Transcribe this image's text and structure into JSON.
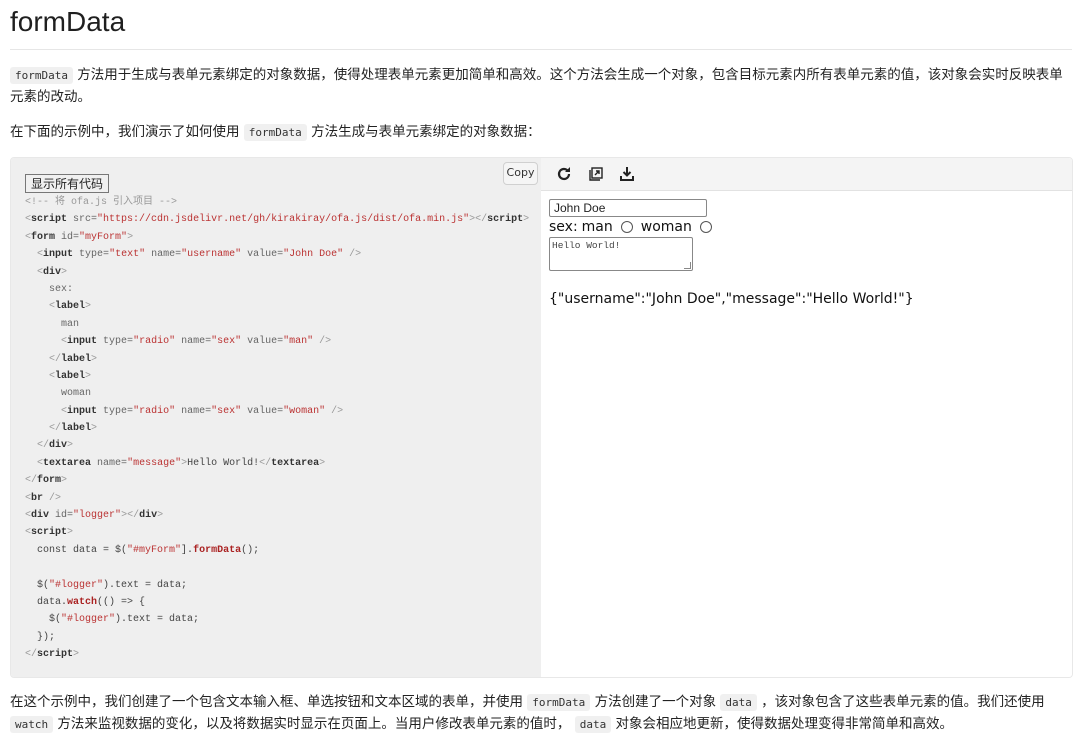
{
  "page": {
    "title": "formData",
    "intro": {
      "code": "formData",
      "text": "方法用于生成与表单元素绑定的对象数据，使得处理表单元素更加简单和高效。这个方法会生成一个对象，包含目标元素内所有表单元素的值，该对象会实时反映表单元素的改动。"
    },
    "example_intro": {
      "before": "在下面的示例中，我们演示了如何使用",
      "code": "formData",
      "after": "方法生成与表单元素绑定的对象数据："
    },
    "outro": {
      "p1": "在这个示例中，我们创建了一个包含文本输入框、单选按钮和文本区域的表单，并使用",
      "c1": "formData",
      "p2": "方法创建了一个对象",
      "c2": "data",
      "p3": "，该对象包含了这些表单元素的值。我们还使用",
      "c3": "watch",
      "p4": "方法来监视数据的变化，以及将数据实时显示在页面上。当用户修改表单元素的值时，",
      "c4": "data",
      "p5": "对象会相应地更新，使得数据处理变得非常简单和高效。"
    }
  },
  "demo": {
    "show_all_label": "显示所有代码",
    "copy_label": "Copy",
    "toolbar_icons": [
      "refresh-icon",
      "open-external-icon",
      "download-icon"
    ],
    "code_lines": [
      [
        [
          "c",
          "<!-- 将 ofa.js 引入项目 -->"
        ]
      ],
      [
        [
          "p",
          "<"
        ],
        [
          "t",
          "script"
        ],
        [
          "a",
          " src="
        ],
        [
          "s",
          "\"https://cdn.jsdelivr.net/gh/kirakiray/ofa.js/dist/ofa.min.js\""
        ],
        [
          "p",
          "></"
        ],
        [
          "t",
          "script"
        ],
        [
          "p",
          ">"
        ]
      ],
      [
        [
          "p",
          "<"
        ],
        [
          "t",
          "form"
        ],
        [
          "a",
          " id="
        ],
        [
          "s",
          "\"myForm\""
        ],
        [
          "p",
          ">"
        ]
      ],
      [
        [
          "x",
          "  "
        ],
        [
          "p",
          "<"
        ],
        [
          "t",
          "input"
        ],
        [
          "a",
          " type="
        ],
        [
          "s",
          "\"text\""
        ],
        [
          "a",
          " name="
        ],
        [
          "s",
          "\"username\""
        ],
        [
          "a",
          " value="
        ],
        [
          "s",
          "\"John Doe\""
        ],
        [
          "p",
          " />"
        ]
      ],
      [
        [
          "x",
          "  "
        ],
        [
          "p",
          "<"
        ],
        [
          "t",
          "div"
        ],
        [
          "p",
          ">"
        ]
      ],
      [
        [
          "x",
          "    sex:"
        ]
      ],
      [
        [
          "x",
          "    "
        ],
        [
          "p",
          "<"
        ],
        [
          "t",
          "label"
        ],
        [
          "p",
          ">"
        ]
      ],
      [
        [
          "x",
          "      man"
        ]
      ],
      [
        [
          "x",
          "      "
        ],
        [
          "p",
          "<"
        ],
        [
          "t",
          "input"
        ],
        [
          "a",
          " type="
        ],
        [
          "s",
          "\"radio\""
        ],
        [
          "a",
          " name="
        ],
        [
          "s",
          "\"sex\""
        ],
        [
          "a",
          " value="
        ],
        [
          "s",
          "\"man\""
        ],
        [
          "p",
          " />"
        ]
      ],
      [
        [
          "x",
          "    "
        ],
        [
          "p",
          "</"
        ],
        [
          "t",
          "label"
        ],
        [
          "p",
          ">"
        ]
      ],
      [
        [
          "x",
          "    "
        ],
        [
          "p",
          "<"
        ],
        [
          "t",
          "label"
        ],
        [
          "p",
          ">"
        ]
      ],
      [
        [
          "x",
          "      woman"
        ]
      ],
      [
        [
          "x",
          "      "
        ],
        [
          "p",
          "<"
        ],
        [
          "t",
          "input"
        ],
        [
          "a",
          " type="
        ],
        [
          "s",
          "\"radio\""
        ],
        [
          "a",
          " name="
        ],
        [
          "s",
          "\"sex\""
        ],
        [
          "a",
          " value="
        ],
        [
          "s",
          "\"woman\""
        ],
        [
          "p",
          " />"
        ]
      ],
      [
        [
          "x",
          "    "
        ],
        [
          "p",
          "</"
        ],
        [
          "t",
          "label"
        ],
        [
          "p",
          ">"
        ]
      ],
      [
        [
          "x",
          "  "
        ],
        [
          "p",
          "</"
        ],
        [
          "t",
          "div"
        ],
        [
          "p",
          ">"
        ]
      ],
      [
        [
          "x",
          "  "
        ],
        [
          "p",
          "<"
        ],
        [
          "t",
          "textarea"
        ],
        [
          "a",
          " name="
        ],
        [
          "s",
          "\"message\""
        ],
        [
          "p",
          ">"
        ],
        [
          "v",
          "Hello World!"
        ],
        [
          "p",
          "</"
        ],
        [
          "t",
          "textarea"
        ],
        [
          "p",
          ">"
        ]
      ],
      [
        [
          "p",
          "</"
        ],
        [
          "t",
          "form"
        ],
        [
          "p",
          ">"
        ]
      ],
      [
        [
          "p",
          "<"
        ],
        [
          "t",
          "br"
        ],
        [
          "p",
          " />"
        ]
      ],
      [
        [
          "p",
          "<"
        ],
        [
          "t",
          "div"
        ],
        [
          "a",
          " id="
        ],
        [
          "s",
          "\"logger\""
        ],
        [
          "p",
          "></"
        ],
        [
          "t",
          "div"
        ],
        [
          "p",
          ">"
        ]
      ],
      [
        [
          "p",
          "<"
        ],
        [
          "t",
          "script"
        ],
        [
          "p",
          ">"
        ]
      ],
      [
        [
          "v",
          "  const data = $("
        ],
        [
          "s",
          "\"#myForm\""
        ],
        [
          "v",
          "]."
        ],
        [
          "k",
          "formData"
        ],
        [
          "v",
          "();"
        ]
      ],
      [
        [
          "x",
          " "
        ]
      ],
      [
        [
          "v",
          "  $("
        ],
        [
          "s",
          "\"#logger\""
        ],
        [
          "v",
          ").text = data;"
        ]
      ],
      [
        [
          "v",
          "  data."
        ],
        [
          "k",
          "watch"
        ],
        [
          "v",
          "(() => {"
        ]
      ],
      [
        [
          "v",
          "    $("
        ],
        [
          "s",
          "\"#logger\""
        ],
        [
          "v",
          ").text = data;"
        ]
      ],
      [
        [
          "v",
          "  });"
        ]
      ],
      [
        [
          "p",
          "</"
        ],
        [
          "t",
          "script"
        ],
        [
          "p",
          ">"
        ]
      ]
    ],
    "preview": {
      "username_value": "John Doe",
      "sex_label": "sex:",
      "option_man": "man",
      "option_woman": "woman",
      "message_value": "Hello World!",
      "logger_text": "{\"username\":\"John Doe\",\"message\":\"Hello World!\"}"
    }
  }
}
